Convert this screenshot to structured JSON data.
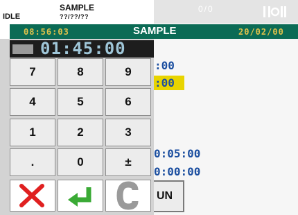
{
  "status_bar": {
    "state": "IDLE",
    "batch_name": "SAMPLE",
    "batch_date": "??/??/??",
    "counter": "0/0",
    "alarm_icon": "alarm-bell-icon"
  },
  "header": {
    "time": "08:56:03",
    "title": "SAMPLE",
    "date": "20/02/00"
  },
  "keypad": {
    "display_value": "01:45:00",
    "keys": [
      "7",
      "8",
      "9",
      "4",
      "5",
      "6",
      "1",
      "2",
      "3",
      ".",
      "0",
      "±"
    ],
    "actions": {
      "cancel_icon": "cross-icon",
      "enter_icon": "enter-arrow-icon",
      "clear_icon": "clear-c-icon"
    }
  },
  "background": {
    "field1": ":00",
    "field2_highlighted": ":00",
    "field3": "0:05:00",
    "field4": "0:00:00",
    "button_label": "UN"
  },
  "colors": {
    "header_bg": "#0b6b55",
    "header_text": "#e0c24a",
    "value_text": "#1c4fa0",
    "highlight": "#e8d400"
  }
}
